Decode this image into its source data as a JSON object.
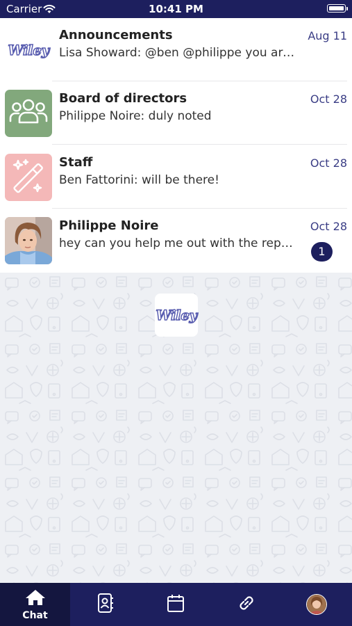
{
  "status_bar": {
    "carrier": "Carrier",
    "time": "10:41 PM"
  },
  "chats": [
    {
      "name": "Announcements",
      "preview": "Lisa Showard: @ben @philippe you are …",
      "date": "Aug 11",
      "avatar": "wiley-logo",
      "avatar_text": "Wiley"
    },
    {
      "name": "Board of directors",
      "preview": "Philippe Noire: duly noted",
      "date": "Oct 28",
      "avatar": "group-icon",
      "avatar_color": "#82a87c"
    },
    {
      "name": "Staff",
      "preview": "Ben Fattorini: will be there!",
      "date": "Oct 28",
      "avatar": "magic-wand-icon",
      "avatar_color": "#f4b8b8"
    },
    {
      "name": "Philippe Noire",
      "preview": "hey can you help me out with the repo…",
      "date": "Oct 28",
      "avatar": "person-photo",
      "unread_count": "1"
    }
  ],
  "center_logo_text": "Wiley",
  "tab_bar": {
    "tabs": [
      {
        "label": "Chat",
        "icon": "home-icon",
        "active": true
      },
      {
        "label": "",
        "icon": "contacts-icon",
        "active": false
      },
      {
        "label": "",
        "icon": "calendar-icon",
        "active": false
      },
      {
        "label": "",
        "icon": "link-icon",
        "active": false
      },
      {
        "label": "",
        "icon": "profile-avatar",
        "active": false
      }
    ]
  },
  "colors": {
    "navy": "#1d1f5e",
    "date_text": "#3a3d85",
    "board_avatar": "#82a87c",
    "staff_avatar": "#f4b8b8"
  }
}
